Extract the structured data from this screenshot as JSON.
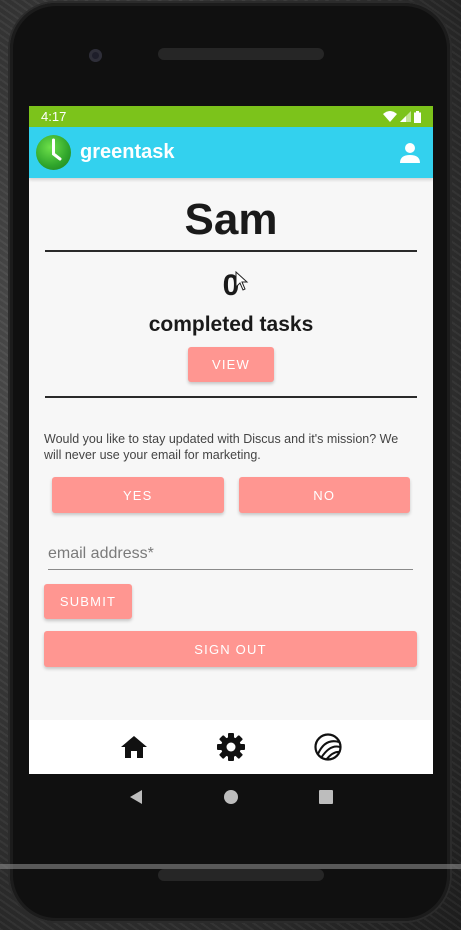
{
  "status_bar": {
    "time": "4:17"
  },
  "app_bar": {
    "title": "greentask",
    "logo_icon": "clock-logo-icon",
    "profile_icon": "person-icon"
  },
  "profile": {
    "name": "Sam",
    "completed_count": "0",
    "completed_label": "completed tasks",
    "view_label": "VIEW"
  },
  "newsletter": {
    "question": "Would you like to stay updated with Discus and it's mission? We will never use your email for marketing.",
    "yes_label": "YES",
    "no_label": "NO",
    "email_placeholder": "email address*",
    "submit_label": "SUBMIT"
  },
  "sign_out_label": "SIGN OUT",
  "bottom_nav": {
    "items": [
      "home-icon",
      "gear-icon",
      "globe-icon"
    ]
  },
  "colors": {
    "status_bar": "#7cc31b",
    "app_bar": "#33d1ee",
    "button": "#ff9691"
  }
}
